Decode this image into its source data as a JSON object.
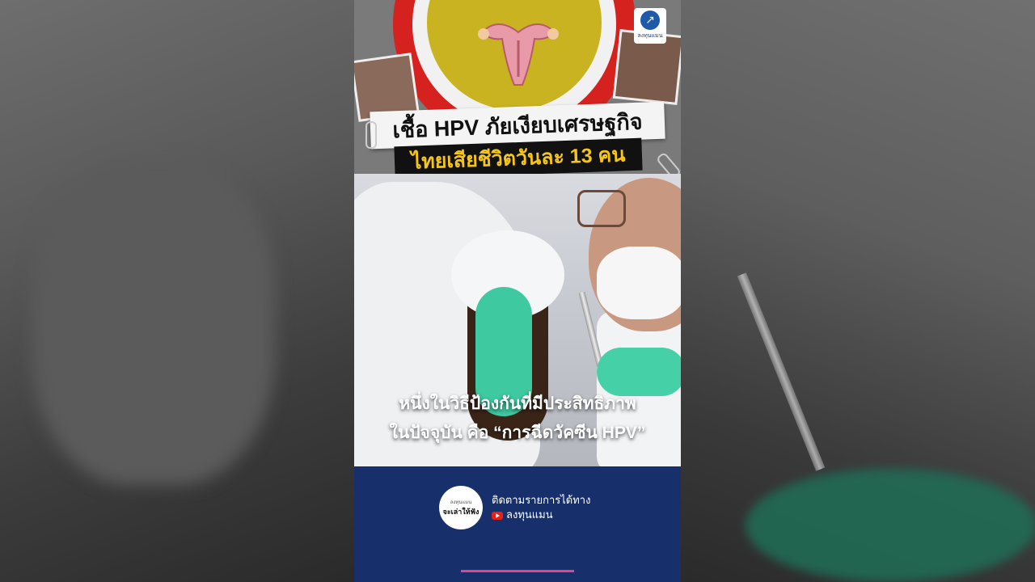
{
  "headline": {
    "line1": "เชื้อ HPV ภัยเงียบเศรษฐกิจ",
    "line2": "ไทยเสียชีวิตวันละ 13 คน"
  },
  "logo": {
    "text": "ลงทุนแมน"
  },
  "caption": {
    "line1": "หนึ่งในวิธีป้องกันที่มีประสิทธิภาพ",
    "line2": "ในปัจจุบัน คือ “การฉีดวัคซีน HPV”"
  },
  "footer": {
    "badge_small": "ลงทุนแมน",
    "badge_big": "จะเล่าให้ฟัง",
    "follow_text": "ติดตามรายการได้ทาง",
    "channel": "ลงทุนแมน"
  },
  "colors": {
    "headline_highlight": "#f5c518",
    "footer_bg": "#17306b",
    "progress": "#e0448a"
  }
}
